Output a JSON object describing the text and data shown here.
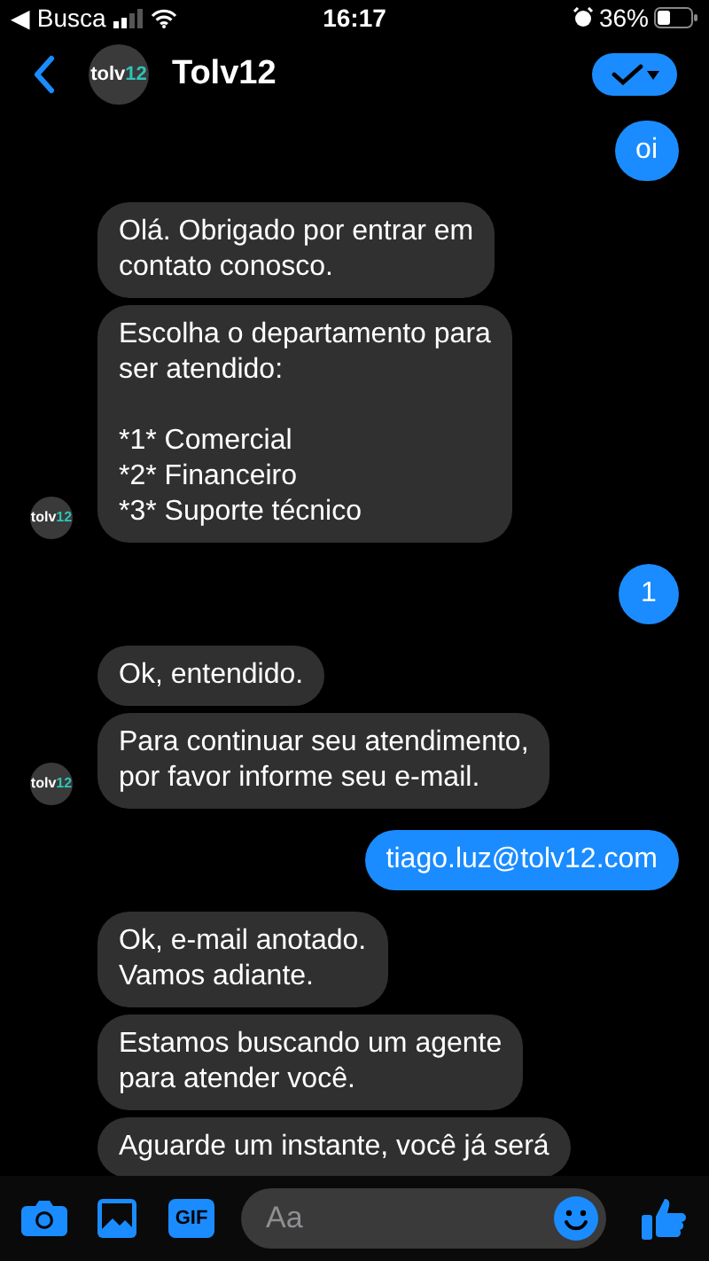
{
  "status_bar": {
    "back_app": "◀ Busca",
    "time": "16:17",
    "battery": "36%"
  },
  "header": {
    "logo": {
      "text": "tolv",
      "accent": "12"
    },
    "name": "Tolv12"
  },
  "messages": [
    {
      "kind": "sent",
      "text": "oi"
    },
    {
      "kind": "received",
      "text": "Olá. Obrigado por entrar em\ncontato conosco."
    },
    {
      "kind": "received",
      "text": "Escolha o departamento para\nser atendido:\n\n*1* Comercial\n*2* Financeiro\n*3* Suporte técnico",
      "avatar": {
        "text": "tolv",
        "accent": "12"
      }
    },
    {
      "kind": "sent",
      "text": "1"
    },
    {
      "kind": "received",
      "text": "Ok, entendido."
    },
    {
      "kind": "received",
      "text": "Para continuar seu atendimento,\npor favor informe seu e-mail.",
      "avatar": {
        "text": "tolv",
        "accent": "12"
      }
    },
    {
      "kind": "sent",
      "text": "tiago.luz@tolv12.com"
    },
    {
      "kind": "received",
      "text": "Ok, e-mail anotado.\nVamos adiante."
    },
    {
      "kind": "received",
      "text": "Estamos buscando um agente\npara atender você."
    },
    {
      "kind": "received",
      "text": "Aguarde um instante, você já será"
    }
  ],
  "composer": {
    "placeholder": "Aa",
    "gif_label": "GIF"
  }
}
